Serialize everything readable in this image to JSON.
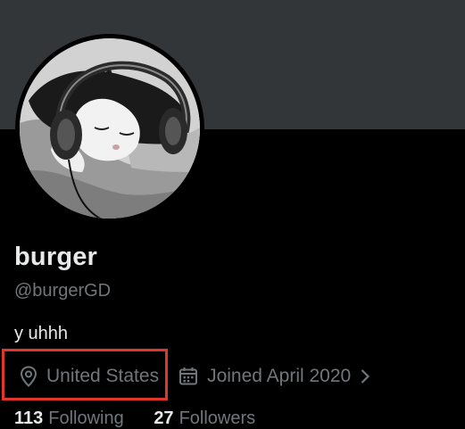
{
  "profile": {
    "display_name": "burger",
    "handle": "@burgerGD",
    "bio": "y uhhh",
    "location": "United States",
    "joined": "Joined April 2020",
    "following_count": "113",
    "following_label": "Following",
    "followers_count": "27",
    "followers_label": "Followers"
  },
  "icons": {
    "location": "location-pin-icon",
    "calendar": "calendar-icon",
    "chevron": "chevron-right-icon"
  },
  "colors": {
    "background": "#000000",
    "banner": "#333639",
    "primary_text": "#e7e9ea",
    "secondary_text": "#71767b",
    "highlight_box": "#e0362c"
  }
}
